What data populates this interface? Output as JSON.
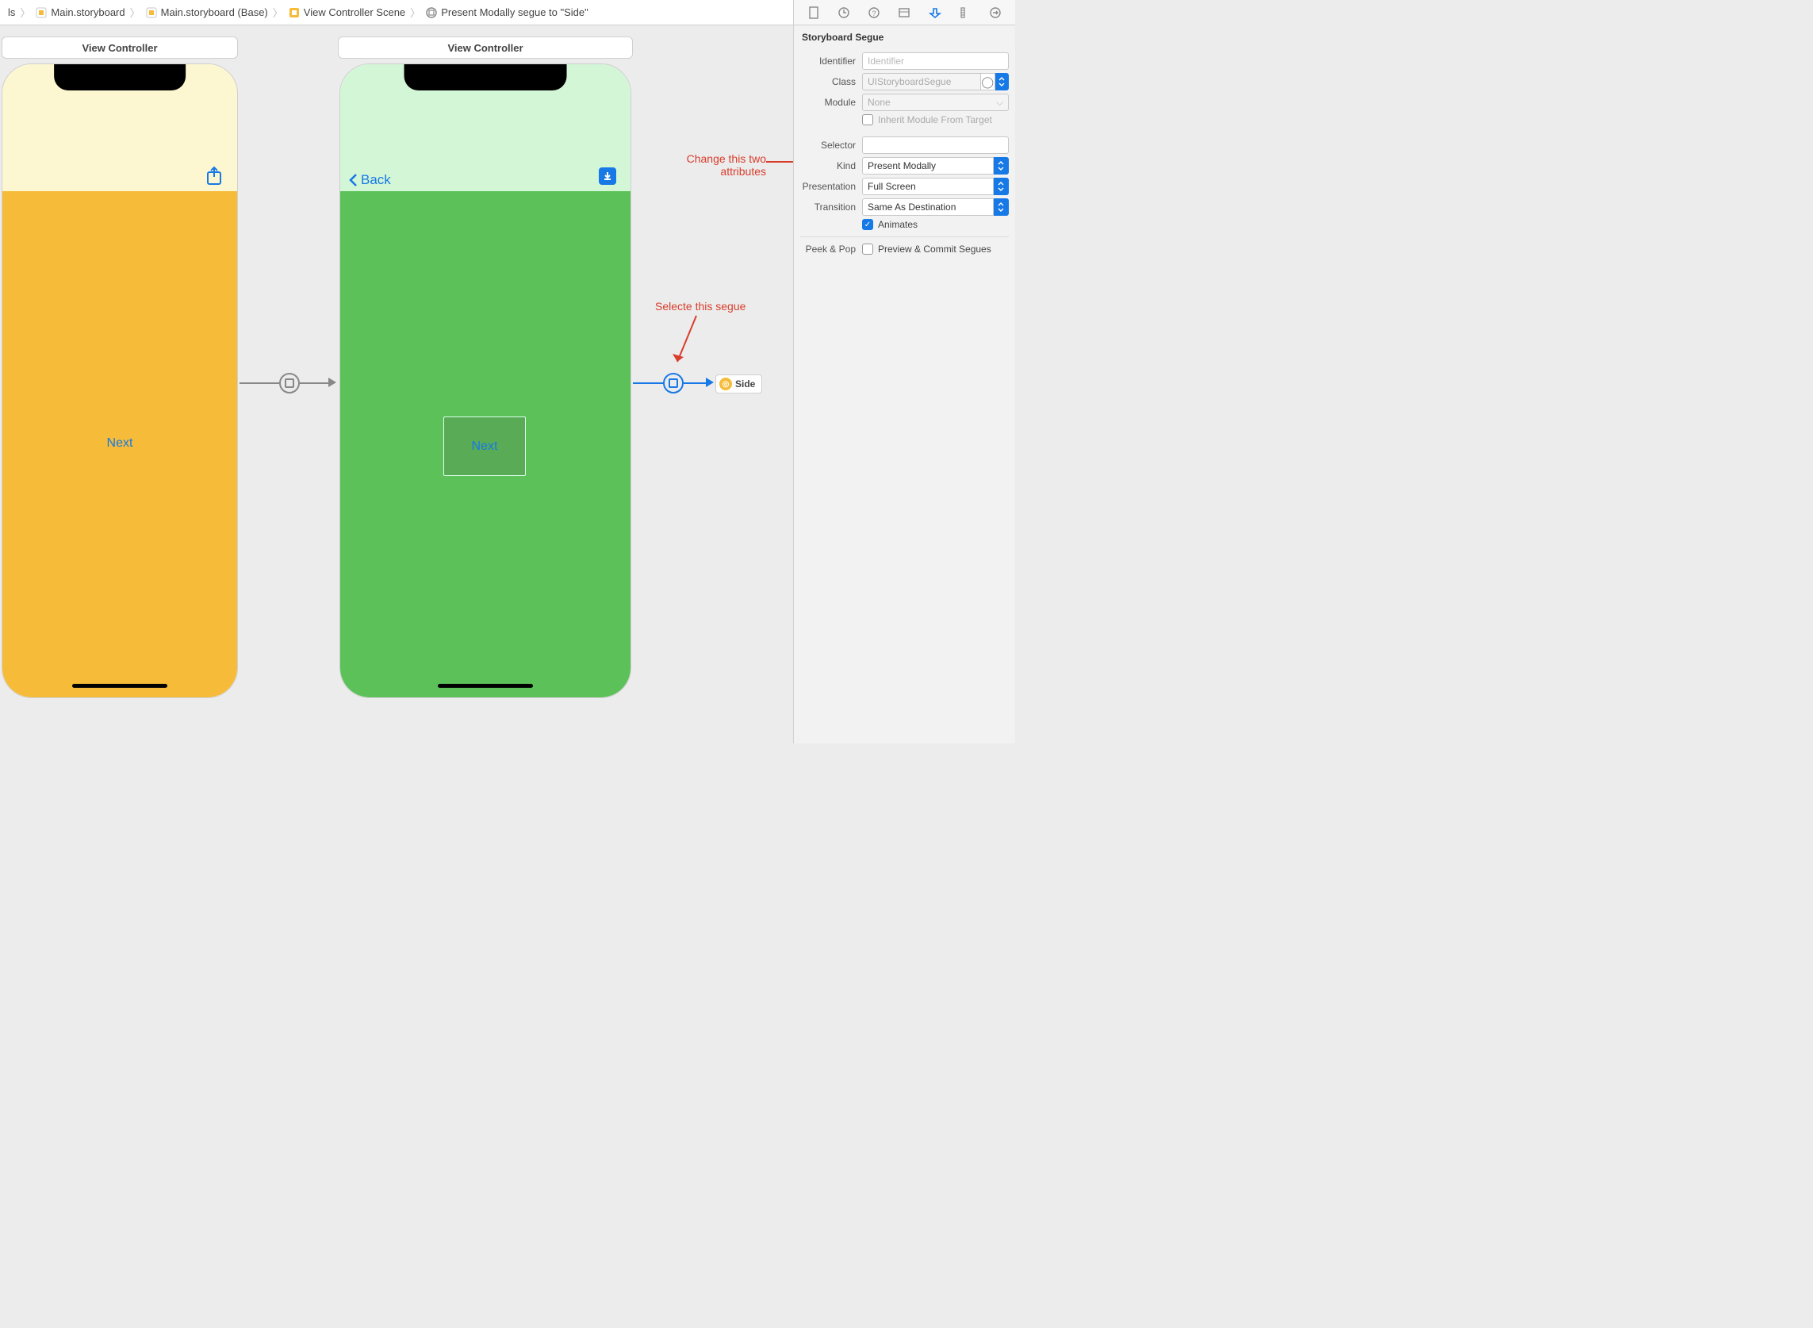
{
  "breadcrumb": {
    "items": [
      {
        "label": "ls"
      },
      {
        "label": "Main.storyboard"
      },
      {
        "label": "Main.storyboard (Base)"
      },
      {
        "label": "View Controller Scene"
      },
      {
        "label": "Present Modally segue to \"Side\""
      }
    ]
  },
  "canvas": {
    "vc_left_title": "View Controller",
    "vc_right_title": "View Controller",
    "left_button": "Next",
    "right_back": "Back",
    "right_container_label": "Next",
    "side_token": "Side"
  },
  "annotations": {
    "segue_text": "Selecte this segue",
    "attrs_text_line1": "Change this two",
    "attrs_text_line2": "attributes"
  },
  "inspector": {
    "section_title": "Storyboard Segue",
    "identifier_label": "Identifier",
    "identifier_placeholder": "Identifier",
    "class_label": "Class",
    "class_value": "UIStoryboardSegue",
    "module_label": "Module",
    "module_value": "None",
    "inherit_label": "Inherit Module From Target",
    "selector_label": "Selector",
    "selector_value": "",
    "kind_label": "Kind",
    "kind_value": "Present Modally",
    "presentation_label": "Presentation",
    "presentation_value": "Full Screen",
    "transition_label": "Transition",
    "transition_value": "Same As Destination",
    "animates_label": "Animates",
    "peek_label": "Peek & Pop",
    "peek_value": "Preview & Commit Segues"
  }
}
